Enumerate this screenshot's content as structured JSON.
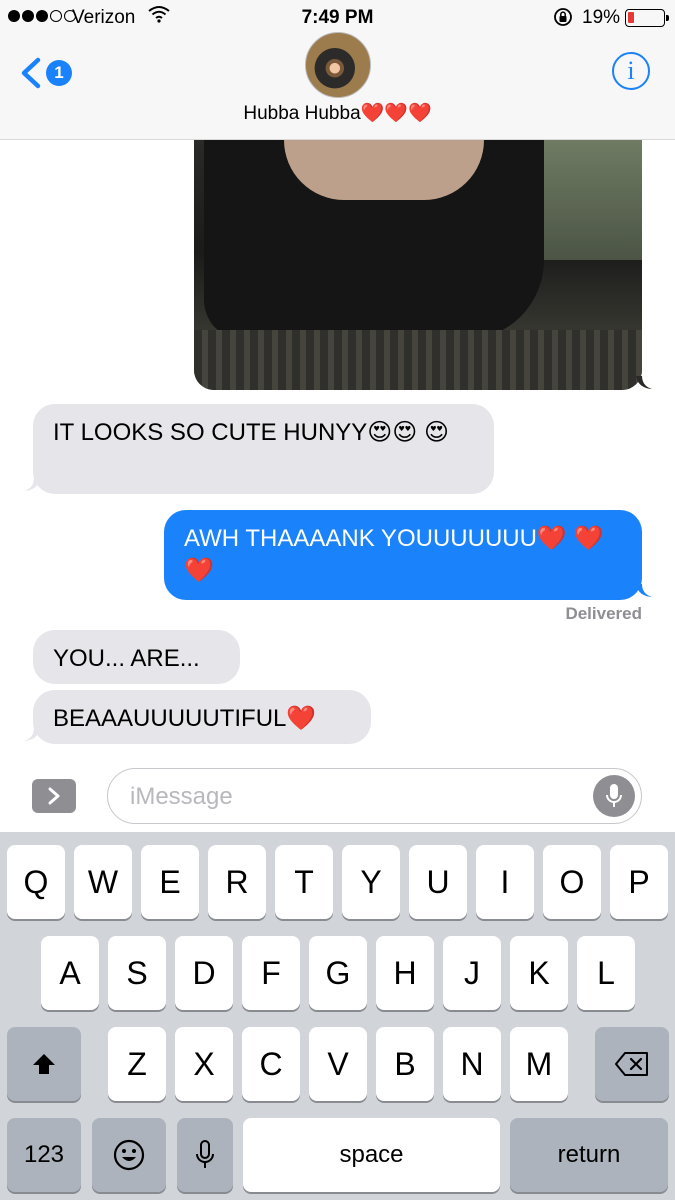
{
  "status": {
    "carrier": "Verizon",
    "time": "7:49 PM",
    "battery_percent": "19%",
    "battery_level": 0.19,
    "signal_bars": 3,
    "signal_total": 5
  },
  "header": {
    "back_badge": "1",
    "contact_name": "Hubba Hubba❤️❤️❤️",
    "info_label": "i"
  },
  "messages": [
    {
      "direction": "incoming",
      "text": "IT LOOKS SO CUTE HUNYY😍😍 😍"
    },
    {
      "direction": "outgoing",
      "text": "AWH THAAAANK YOUUUUUUU❤️ ❤️❤️"
    },
    {
      "direction": "incoming",
      "text": "YOU... ARE..."
    },
    {
      "direction": "incoming",
      "text": "BEAAAUUUUUTIFUL❤️"
    }
  ],
  "delivered_label": "Delivered",
  "composer": {
    "placeholder": "iMessage"
  },
  "keyboard": {
    "row1": [
      "Q",
      "W",
      "E",
      "R",
      "T",
      "Y",
      "U",
      "I",
      "O",
      "P"
    ],
    "row2": [
      "A",
      "S",
      "D",
      "F",
      "G",
      "H",
      "J",
      "K",
      "L"
    ],
    "row3": [
      "Z",
      "X",
      "C",
      "V",
      "B",
      "N",
      "M"
    ],
    "numbers_label": "123",
    "space_label": "space",
    "return_label": "return"
  },
  "colors": {
    "accent": "#1a82fb",
    "incoming_bubble": "#e5e5ea",
    "keyboard_bg": "#d1d4d9",
    "battery_low": "#e53935"
  },
  "icons": {
    "back": "chevron-left-icon",
    "info": "info-icon",
    "apps": "chevron-right-icon",
    "mic": "microphone-icon",
    "shift": "shift-arrow-icon",
    "backspace": "backspace-icon",
    "emoji": "emoji-icon",
    "dictation": "microphone-icon"
  }
}
